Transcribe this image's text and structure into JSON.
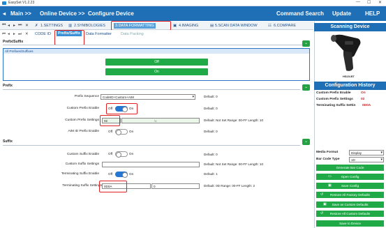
{
  "window": {
    "title": "EasySet V1.2.23",
    "controls": [
      "—",
      "☐",
      "✕"
    ]
  },
  "menu": {
    "main": "Main >>",
    "online": "Online Device >>",
    "configure": "Configure Device",
    "command_search": "Command Search",
    "update": "Update",
    "help": "HELP"
  },
  "tabs": [
    "1.SETTINGS",
    "2.SYMBOLOGIES",
    "3.DATA FORMATTING",
    "4.IMAGING",
    "5.SCAN DATA WINDOW",
    "6.COMPARE"
  ],
  "subtabs": [
    "CODE ID",
    "Prefix/Suffix",
    "Data Formatter",
    "Data Packing"
  ],
  "prefix_suffix_section": {
    "title": "Prefix/Suffix",
    "panel_header": "All Prefixes/Suffixes",
    "off_label": "Off",
    "on_label": "On"
  },
  "prefix_section": {
    "title": "Prefix",
    "sequence_label": "Prefix Sequence",
    "sequence_value": "CodeID+Custom+AIM",
    "sequence_default": "Default: 0",
    "enable_label": "Custom Prefix Enable",
    "enable_default": "Default: 0",
    "settings_label": "Custom Prefix Settings",
    "settings_value": "02",
    "settings_hex": "\\x",
    "settings_default": "Default: Not Set   Range: 00-FF Length: 10",
    "aim_label": "AIM ID Prefix Enable",
    "aim_default": "Default: 0"
  },
  "suffix_section": {
    "title": "Suffix",
    "enable_label": "Custom Suffix Enable",
    "enable_default": "Default: 0",
    "settings_label": "Custom Suffix Settings",
    "settings_default": "Default: Not Set   Range: 00-FF Length: 10",
    "term_enable_label": "Terminating Suffix Enable",
    "term_enable_default": "Default: 1",
    "term_settings_label": "Terminating Suffix Settings",
    "term_settings_value": "0D0A",
    "term_settings_aux": "0",
    "term_settings_default": "Default: 0D   Range: 00-FF Length: 2"
  },
  "toggle": {
    "off": "Off",
    "on": "On"
  },
  "right_panel": {
    "device_title": "Scanning Device",
    "model": "HS15-BT",
    "history_title": "Configuration History",
    "history": [
      {
        "label": "Custom Prefix Enable",
        "value": "On"
      },
      {
        "label": "Custom Prefix Settings",
        "value": "02"
      },
      {
        "label": "Terminating Suffix Settin",
        "value": "0D0A"
      }
    ],
    "media_format_label": "Media Format",
    "media_format_value": "Display",
    "bar_code_type_label": "Bar Code Type",
    "bar_code_type_value": "1D",
    "buttons": [
      "Generate Bar Code",
      "Open Config",
      "Save Config",
      "Restore All Factory Defaults",
      "Save as Custom Defaults",
      "Restore All Custom Defaults",
      "Save to Device"
    ]
  },
  "colors": {
    "brand_blue": "#1f6fb6",
    "action_green": "#1faa47",
    "highlight_red": "#e02020",
    "toggle_on": "#2577d1"
  }
}
